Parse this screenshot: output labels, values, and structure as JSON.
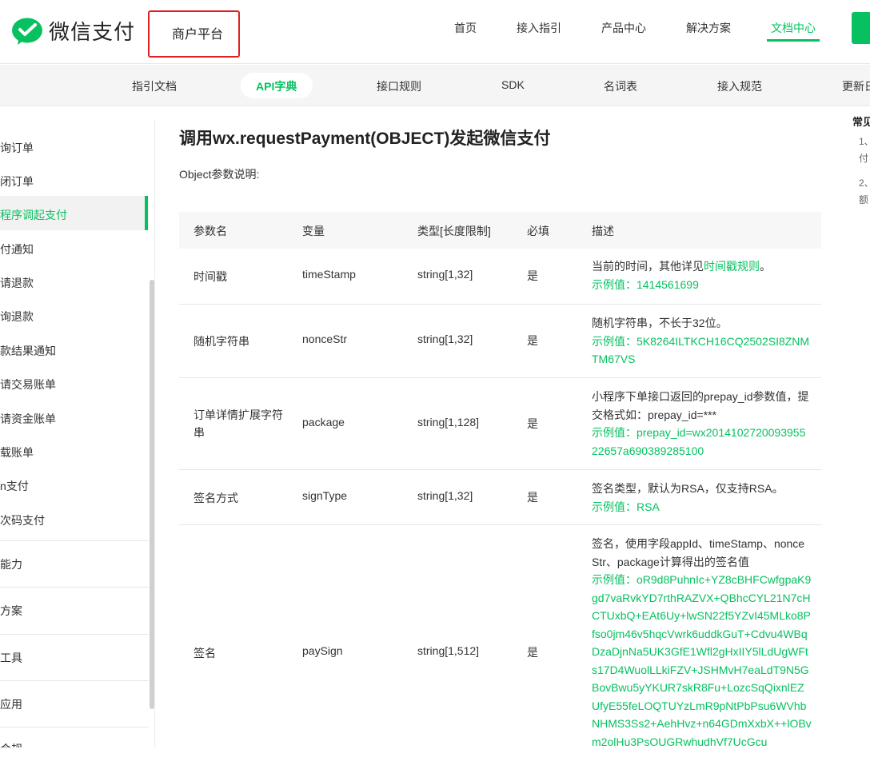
{
  "header": {
    "logo_text": "微信支付",
    "platform": "商户平台",
    "nav": [
      "首页",
      "接入指引",
      "产品中心",
      "解决方案",
      "文档中心"
    ],
    "active_nav": "文档中心"
  },
  "subnav": {
    "items": [
      "指引文档",
      "API字典",
      "接口规则",
      "SDK",
      "名词表",
      "接入规范",
      "更新日"
    ],
    "active": "API字典"
  },
  "sidebar": {
    "items": [
      "询订单",
      "闭订单",
      "程序调起支付",
      "付通知",
      "请退款",
      "询退款",
      "款结果通知",
      "请交易账单",
      "请资金账单",
      "载账单",
      "n支付",
      "次码支付",
      "能力",
      "方案",
      "工具",
      "应用",
      "合规"
    ],
    "active_index": 2
  },
  "main": {
    "title": "调用wx.requestPayment(OBJECT)发起微信支付",
    "intro": "Object参数说明:",
    "table": {
      "headers": [
        "参数名",
        "变量",
        "类型[长度限制]",
        "必填",
        "描述"
      ],
      "rows": [
        {
          "name": "时间戳",
          "var": "timeStamp",
          "type": "string[1,32]",
          "req": "是",
          "desc_pre": "当前的时间，其他详见",
          "desc_link": "时间戳规则",
          "desc_post": "。",
          "example": "示例值：1414561699"
        },
        {
          "name": "随机字符串",
          "var": "nonceStr",
          "type": "string[1,32]",
          "req": "是",
          "desc": "随机字符串，不长于32位。",
          "example": "示例值：5K8264ILTKCH16CQ2502SI8ZNMTM67VS"
        },
        {
          "name": "订单详情扩展字符串",
          "var": "package",
          "type": "string[1,128]",
          "req": "是",
          "desc": "小程序下单接口返回的prepay_id参数值，提交格式如：prepay_id=***",
          "example": "示例值：prepay_id=wx201410272009395522657a690389285100"
        },
        {
          "name": "签名方式",
          "var": "signType",
          "type": "string[1,32]",
          "req": "是",
          "desc": "签名类型，默认为RSA，仅支持RSA。",
          "example": "示例值：RSA"
        },
        {
          "name": "签名",
          "var": "paySign",
          "type": "string[1,512]",
          "req": "是",
          "desc": "签名，使用字段appId、timeStamp、nonceStr、package计算得出的签名值",
          "example": "示例值：oR9d8PuhnIc+YZ8cBHFCwfgpaK9gd7vaRvkYD7rthRAZVX+QBhcCYL21N7cHCTUxbQ+EAt6Uy+lwSN22f5YZvI45MLko8Pfso0jm46v5hqcVwrk6uddkGuT+Cdvu4WBqDzaDjnNa5UK3GfE1Wfl2gHxIIY5lLdUgWFts17D4WuolLLkiFZV+JSHMvH7eaLdT9N5GBovBwu5yYKUR7skR8Fu+LozcSqQixnlEZUfyE55feLOQTUYzLmR9pNtPbPsu6WVhbNHMS3Ss2+AehHvz+n64GDmXxbX++lOBvm2olHu3PsOUGRwhudhVf7UcGcu"
        }
      ]
    }
  },
  "right": {
    "title": "常见",
    "lines": [
      "1、",
      "付",
      "2、",
      "额"
    ]
  },
  "colors": {
    "accent": "#07c160",
    "highlight_box": "#e02020"
  }
}
